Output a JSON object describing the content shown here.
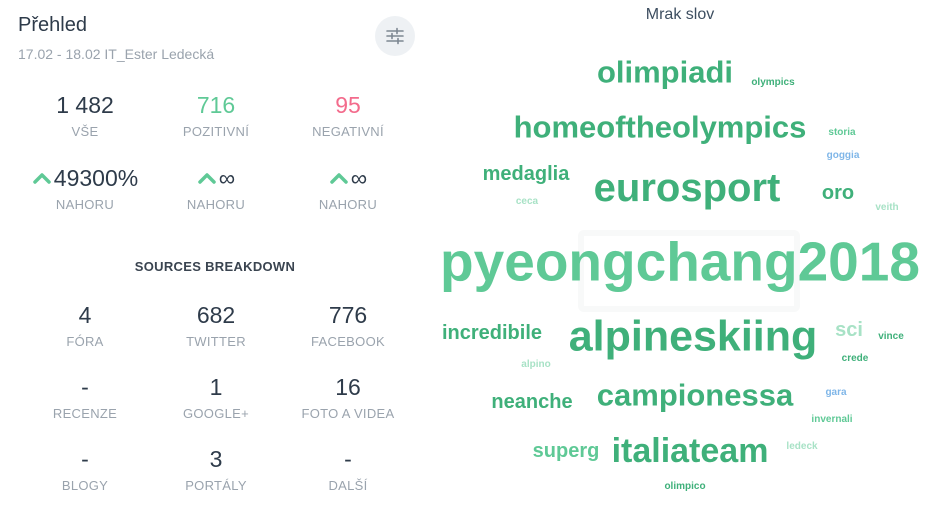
{
  "overview": {
    "title": "Přehled",
    "subtitle": "17.02 - 18.02   IT_Ester Ledecká",
    "filter_icon": "sliders-icon",
    "stats": [
      {
        "value": "1 482",
        "label": "VŠE",
        "tone": "neutral"
      },
      {
        "value": "716",
        "label": "POZITIVNÍ",
        "tone": "positive"
      },
      {
        "value": "95",
        "label": "NEGATIVNÍ",
        "tone": "negative"
      }
    ],
    "trends": [
      {
        "value": "49300%",
        "label": "NAHORU",
        "icon": "arrow-up-icon"
      },
      {
        "value": "∞",
        "label": "NAHORU",
        "icon": "arrow-up-icon"
      },
      {
        "value": "∞",
        "label": "NAHORU",
        "icon": "arrow-up-icon"
      }
    ]
  },
  "sources": {
    "title": "SOURCES BREAKDOWN",
    "items": [
      {
        "value": "4",
        "label": "FÓRA"
      },
      {
        "value": "682",
        "label": "TWITTER"
      },
      {
        "value": "776",
        "label": "FACEBOOK"
      },
      {
        "value": "-",
        "label": "RECENZE"
      },
      {
        "value": "1",
        "label": "GOOGLE+"
      },
      {
        "value": "16",
        "label": "FOTO A VIDEA"
      },
      {
        "value": "-",
        "label": "BLOGY"
      },
      {
        "value": "3",
        "label": "PORTÁLY"
      },
      {
        "value": "-",
        "label": "DALŠÍ"
      }
    ]
  },
  "word_cloud": {
    "title": "Mrak slov",
    "colors": {
      "dark": "#3fb07a",
      "mid": "#5fc996",
      "light": "#a8e2c6",
      "blue": "#7fb6e8"
    },
    "words": [
      {
        "text": "olimpiadi",
        "tone": "dark"
      },
      {
        "text": "olympics",
        "tone": "dark"
      },
      {
        "text": "homeoftheolympics",
        "tone": "dark"
      },
      {
        "text": "storia",
        "tone": "mid"
      },
      {
        "text": "goggia",
        "tone": "blue"
      },
      {
        "text": "medaglia",
        "tone": "dark"
      },
      {
        "text": "eurosport",
        "tone": "dark"
      },
      {
        "text": "oro",
        "tone": "dark"
      },
      {
        "text": "ceca",
        "tone": "light"
      },
      {
        "text": "veith",
        "tone": "light"
      },
      {
        "text": "pyeongchang2018",
        "tone": "mid"
      },
      {
        "text": "incredibile",
        "tone": "dark"
      },
      {
        "text": "alpineskiing",
        "tone": "dark"
      },
      {
        "text": "sci",
        "tone": "light"
      },
      {
        "text": "vince",
        "tone": "dark"
      },
      {
        "text": "crede",
        "tone": "dark"
      },
      {
        "text": "alpino",
        "tone": "light"
      },
      {
        "text": "neanche",
        "tone": "dark"
      },
      {
        "text": "campionessa",
        "tone": "dark"
      },
      {
        "text": "gara",
        "tone": "blue"
      },
      {
        "text": "invernali",
        "tone": "mid"
      },
      {
        "text": "superg",
        "tone": "mid"
      },
      {
        "text": "italiateam",
        "tone": "dark"
      },
      {
        "text": "ledeck",
        "tone": "light"
      },
      {
        "text": "olimpico",
        "tone": "dark"
      }
    ]
  }
}
